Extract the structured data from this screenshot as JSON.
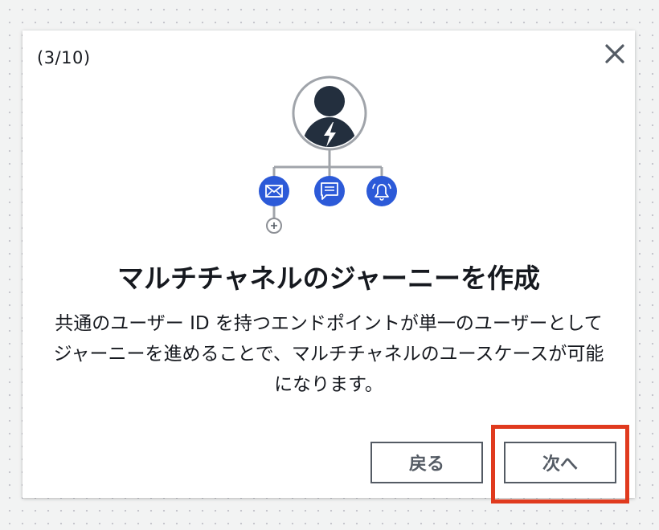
{
  "modal": {
    "step_indicator": "(3/10)",
    "title": "マルチチャネルのジャーニーを作成",
    "description": "共通のユーザー ID を持つエンドポイントが単一のユーザーとしてジャーニーを進めることで、マルチチャネルのユースケースが可能になります。",
    "back_label": "戻る",
    "next_label": "次へ"
  },
  "illustration": {
    "channel_icons": [
      "mail-icon",
      "chat-icon",
      "bell-icon"
    ],
    "accent_color": "#2c5ad8",
    "avatar_color": "#232f3e"
  },
  "highlight_color": "#e03a1e"
}
